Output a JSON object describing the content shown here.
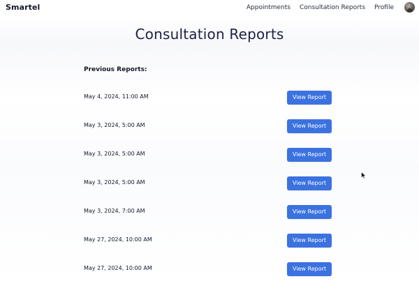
{
  "navbar": {
    "brand": "Smartel",
    "links": [
      "Appointments",
      "Consultation Reports",
      "Profile"
    ]
  },
  "page": {
    "title": "Consultation Reports",
    "section_label": "Previous Reports:"
  },
  "reports": [
    {
      "date": "May 4, 2024, 11:00 AM",
      "action": "View Report"
    },
    {
      "date": "May 3, 2024, 5:00 AM",
      "action": "View Report"
    },
    {
      "date": "May 3, 2024, 5:00 AM",
      "action": "View Report"
    },
    {
      "date": "May 3, 2024, 5:00 AM",
      "action": "View Report"
    },
    {
      "date": "May 3, 2024, 7:00 AM",
      "action": "View Report"
    },
    {
      "date": "May 27, 2024, 10:00 AM",
      "action": "View Report"
    },
    {
      "date": "May 27, 2024, 10:00 AM",
      "action": "View Report"
    }
  ],
  "colors": {
    "button": "#3b72e0",
    "title": "#1b2140"
  },
  "icons": {
    "avatar": "user-avatar",
    "cursor": "mouse-pointer-icon"
  }
}
